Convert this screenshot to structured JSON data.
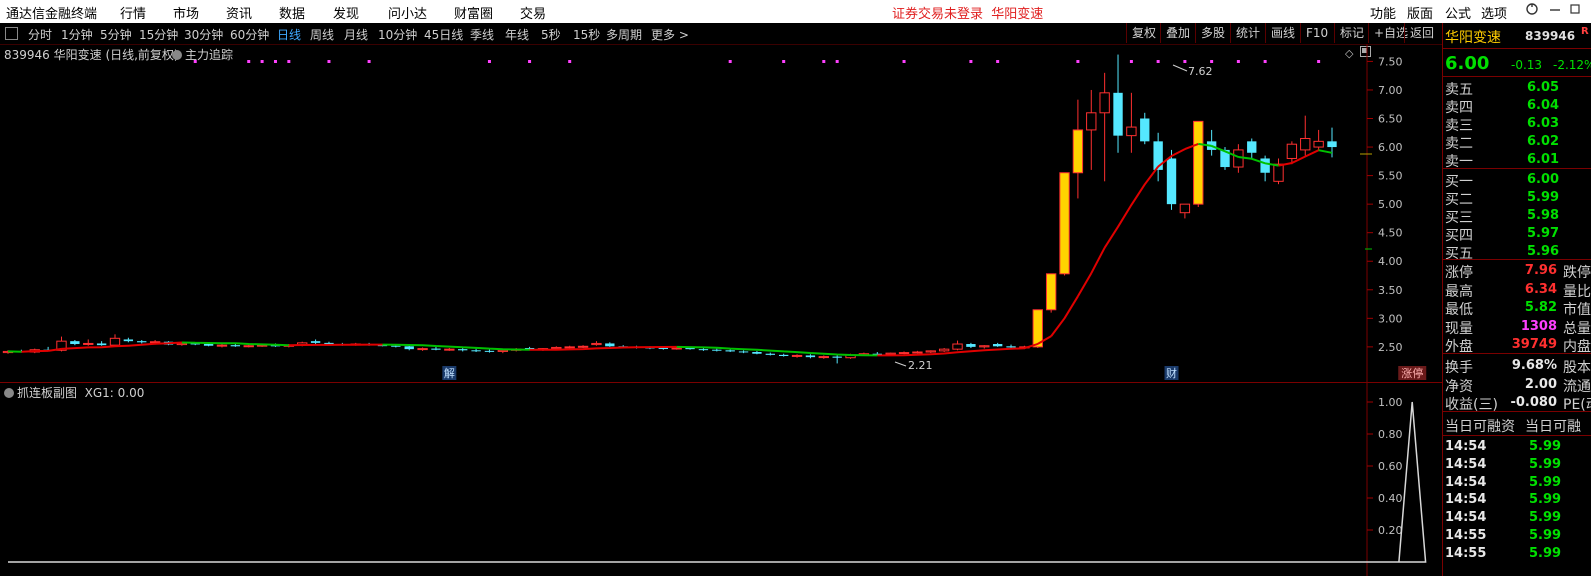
{
  "menubar": {
    "app_title": "通达信金融终端",
    "items": [
      "行情",
      "市场",
      "资讯",
      "数据",
      "发现",
      "问小达",
      "财富圈",
      "交易"
    ],
    "status_text": "证券交易未登录",
    "status_stock": "华阳变速",
    "right_items": [
      "功能",
      "版面",
      "公式",
      "选项"
    ],
    "controls": [
      "user-icon",
      "minimize-icon",
      "maximize-icon",
      "close-icon"
    ]
  },
  "periodbar": {
    "toggle_icon": "panel-toggle-icon",
    "periods": [
      "分时",
      "1分钟",
      "5分钟",
      "15分钟",
      "30分钟",
      "60分钟",
      "日线",
      "周线",
      "月线",
      "10分钟",
      "45日线",
      "季线",
      "年线",
      "5秒",
      "15秒",
      "多周期",
      "更多 >"
    ],
    "active_period": "日线",
    "tools": [
      "复权",
      "叠加",
      "多股",
      "统计",
      "画线",
      "F10",
      "标记",
      "+自选",
      "返回"
    ]
  },
  "main_chart": {
    "title": "839946 华阳变速 (日线,前复权)",
    "indicator": "主力追踪",
    "high_label": "7.62",
    "low_label": "2.21",
    "event_labels": [
      "解",
      "财",
      "涨停"
    ],
    "price_axis": [
      "7.50",
      "7.00",
      "6.50",
      "6.00",
      "5.50",
      "5.00",
      "4.50",
      "4.00",
      "3.50",
      "3.00",
      "2.50"
    ]
  },
  "sub_chart": {
    "title": "抓连板副图",
    "indicator_value": "XG1: 0.00",
    "axis": [
      "1.00",
      "0.80",
      "0.60",
      "0.40",
      "0.20"
    ]
  },
  "quote": {
    "name": "华阳变速",
    "code": "839946",
    "badge": "R",
    "price": "6.00",
    "change": "-0.13",
    "change_pct": "-2.12%",
    "asks": [
      {
        "label": "卖五",
        "price": "6.05"
      },
      {
        "label": "卖四",
        "price": "6.04"
      },
      {
        "label": "卖三",
        "price": "6.03"
      },
      {
        "label": "卖二",
        "price": "6.02"
      },
      {
        "label": "卖一",
        "price": "6.01"
      }
    ],
    "bids": [
      {
        "label": "买一",
        "price": "6.00"
      },
      {
        "label": "买二",
        "price": "5.99"
      },
      {
        "label": "买三",
        "price": "5.98"
      },
      {
        "label": "买四",
        "price": "5.97"
      },
      {
        "label": "买五",
        "price": "5.96"
      }
    ],
    "stats": [
      {
        "label": "涨停",
        "value": "7.96",
        "color": "red",
        "label2": "跌停"
      },
      {
        "label": "最高",
        "value": "6.34",
        "color": "red",
        "label2": "量比"
      },
      {
        "label": "最低",
        "value": "5.82",
        "color": "green",
        "label2": "市值"
      },
      {
        "label": "现量",
        "value": "1308",
        "color": "mag",
        "label2": "总量"
      },
      {
        "label": "外盘",
        "value": "39749",
        "color": "red",
        "label2": "内盘"
      }
    ],
    "stats2": [
      {
        "label": "换手",
        "value": "9.68%",
        "color": "white",
        "label2": "股本"
      },
      {
        "label": "净资",
        "value": "2.00",
        "color": "white",
        "label2": "流通"
      },
      {
        "label": "收益(三)",
        "value": "-0.080",
        "color": "white",
        "label2": "PE(动"
      }
    ],
    "margin_header": [
      "当日可融资",
      "当日可融"
    ],
    "ticks": [
      {
        "time": "14:54",
        "price": "5.99"
      },
      {
        "time": "14:54",
        "price": "5.99"
      },
      {
        "time": "14:54",
        "price": "5.99"
      },
      {
        "time": "14:54",
        "price": "5.99"
      },
      {
        "time": "14:54",
        "price": "5.99"
      },
      {
        "time": "14:55",
        "price": "5.99"
      },
      {
        "time": "14:55",
        "price": "5.99"
      }
    ]
  },
  "chart_data": {
    "type": "candlestick",
    "title": "839946 华阳变速 (日线,前复权)",
    "y_range": [
      2.2,
      7.7
    ],
    "candles": [
      {
        "o": 2.4,
        "h": 2.44,
        "l": 2.38,
        "c": 2.42
      },
      {
        "o": 2.42,
        "h": 2.45,
        "l": 2.4,
        "c": 2.41
      },
      {
        "o": 2.41,
        "h": 2.47,
        "l": 2.39,
        "c": 2.45
      },
      {
        "o": 2.45,
        "h": 2.5,
        "l": 2.43,
        "c": 2.44
      },
      {
        "o": 2.44,
        "h": 2.68,
        "l": 2.42,
        "c": 2.6
      },
      {
        "o": 2.6,
        "h": 2.62,
        "l": 2.53,
        "c": 2.55
      },
      {
        "o": 2.55,
        "h": 2.63,
        "l": 2.52,
        "c": 2.56
      },
      {
        "o": 2.56,
        "h": 2.6,
        "l": 2.52,
        "c": 2.53
      },
      {
        "o": 2.53,
        "h": 2.72,
        "l": 2.51,
        "c": 2.65
      },
      {
        "o": 2.63,
        "h": 2.66,
        "l": 2.58,
        "c": 2.6
      },
      {
        "o": 2.6,
        "h": 2.62,
        "l": 2.56,
        "c": 2.58
      },
      {
        "o": 2.58,
        "h": 2.62,
        "l": 2.54,
        "c": 2.59
      },
      {
        "o": 2.59,
        "h": 2.6,
        "l": 2.53,
        "c": 2.54
      },
      {
        "o": 2.54,
        "h": 2.58,
        "l": 2.52,
        "c": 2.56
      },
      {
        "o": 2.56,
        "h": 2.58,
        "l": 2.53,
        "c": 2.55
      },
      {
        "o": 2.55,
        "h": 2.57,
        "l": 2.51,
        "c": 2.52
      },
      {
        "o": 2.52,
        "h": 2.55,
        "l": 2.49,
        "c": 2.53
      },
      {
        "o": 2.53,
        "h": 2.56,
        "l": 2.5,
        "c": 2.51
      },
      {
        "o": 2.51,
        "h": 2.54,
        "l": 2.49,
        "c": 2.52
      },
      {
        "o": 2.52,
        "h": 2.55,
        "l": 2.5,
        "c": 2.53
      },
      {
        "o": 2.53,
        "h": 2.56,
        "l": 2.5,
        "c": 2.51
      },
      {
        "o": 2.51,
        "h": 2.55,
        "l": 2.49,
        "c": 2.53
      },
      {
        "o": 2.53,
        "h": 2.59,
        "l": 2.51,
        "c": 2.57
      },
      {
        "o": 2.6,
        "h": 2.63,
        "l": 2.55,
        "c": 2.57
      },
      {
        "o": 2.57,
        "h": 2.59,
        "l": 2.54,
        "c": 2.55
      },
      {
        "o": 2.55,
        "h": 2.57,
        "l": 2.52,
        "c": 2.54
      },
      {
        "o": 2.54,
        "h": 2.57,
        "l": 2.52,
        "c": 2.55
      },
      {
        "o": 2.55,
        "h": 2.57,
        "l": 2.52,
        "c": 2.53
      },
      {
        "o": 2.53,
        "h": 2.55,
        "l": 2.51,
        "c": 2.52
      },
      {
        "o": 2.52,
        "h": 2.54,
        "l": 2.49,
        "c": 2.51
      },
      {
        "o": 2.51,
        "h": 2.53,
        "l": 2.44,
        "c": 2.46
      },
      {
        "o": 2.46,
        "h": 2.49,
        "l": 2.43,
        "c": 2.47
      },
      {
        "o": 2.47,
        "h": 2.5,
        "l": 2.44,
        "c": 2.45
      },
      {
        "o": 2.45,
        "h": 2.48,
        "l": 2.43,
        "c": 2.46
      },
      {
        "o": 2.46,
        "h": 2.48,
        "l": 2.42,
        "c": 2.44
      },
      {
        "o": 2.44,
        "h": 2.47,
        "l": 2.41,
        "c": 2.43
      },
      {
        "o": 2.43,
        "h": 2.46,
        "l": 2.4,
        "c": 2.42
      },
      {
        "o": 2.42,
        "h": 2.45,
        "l": 2.39,
        "c": 2.44
      },
      {
        "o": 2.44,
        "h": 2.48,
        "l": 2.42,
        "c": 2.46
      },
      {
        "o": 2.48,
        "h": 2.5,
        "l": 2.44,
        "c": 2.45
      },
      {
        "o": 2.45,
        "h": 2.48,
        "l": 2.43,
        "c": 2.47
      },
      {
        "o": 2.47,
        "h": 2.51,
        "l": 2.45,
        "c": 2.49
      },
      {
        "o": 2.49,
        "h": 2.52,
        "l": 2.47,
        "c": 2.5
      },
      {
        "o": 2.5,
        "h": 2.53,
        "l": 2.48,
        "c": 2.51
      },
      {
        "o": 2.54,
        "h": 2.6,
        "l": 2.52,
        "c": 2.56
      },
      {
        "o": 2.56,
        "h": 2.58,
        "l": 2.5,
        "c": 2.51
      },
      {
        "o": 2.51,
        "h": 2.53,
        "l": 2.48,
        "c": 2.5
      },
      {
        "o": 2.5,
        "h": 2.52,
        "l": 2.47,
        "c": 2.49
      },
      {
        "o": 2.49,
        "h": 2.51,
        "l": 2.46,
        "c": 2.48
      },
      {
        "o": 2.48,
        "h": 2.5,
        "l": 2.45,
        "c": 2.47
      },
      {
        "o": 2.47,
        "h": 2.5,
        "l": 2.45,
        "c": 2.48
      },
      {
        "o": 2.48,
        "h": 2.5,
        "l": 2.45,
        "c": 2.46
      },
      {
        "o": 2.46,
        "h": 2.48,
        "l": 2.43,
        "c": 2.45
      },
      {
        "o": 2.45,
        "h": 2.47,
        "l": 2.42,
        "c": 2.44
      },
      {
        "o": 2.44,
        "h": 2.46,
        "l": 2.41,
        "c": 2.42
      },
      {
        "o": 2.42,
        "h": 2.44,
        "l": 2.39,
        "c": 2.41
      },
      {
        "o": 2.41,
        "h": 2.43,
        "l": 2.37,
        "c": 2.38
      },
      {
        "o": 2.38,
        "h": 2.4,
        "l": 2.35,
        "c": 2.36
      },
      {
        "o": 2.36,
        "h": 2.38,
        "l": 2.33,
        "c": 2.34
      },
      {
        "o": 2.34,
        "h": 2.37,
        "l": 2.31,
        "c": 2.35
      },
      {
        "o": 2.35,
        "h": 2.37,
        "l": 2.3,
        "c": 2.32
      },
      {
        "o": 2.32,
        "h": 2.35,
        "l": 2.29,
        "c": 2.33
      },
      {
        "o": 2.33,
        "h": 2.35,
        "l": 2.21,
        "c": 2.31
      },
      {
        "o": 2.31,
        "h": 2.38,
        "l": 2.29,
        "c": 2.36
      },
      {
        "o": 2.36,
        "h": 2.4,
        "l": 2.34,
        "c": 2.38
      },
      {
        "o": 2.38,
        "h": 2.41,
        "l": 2.35,
        "c": 2.37
      },
      {
        "o": 2.37,
        "h": 2.4,
        "l": 2.35,
        "c": 2.39
      },
      {
        "o": 2.39,
        "h": 2.42,
        "l": 2.37,
        "c": 2.4
      },
      {
        "o": 2.4,
        "h": 2.43,
        "l": 2.38,
        "c": 2.41
      },
      {
        "o": 2.41,
        "h": 2.44,
        "l": 2.39,
        "c": 2.43
      },
      {
        "o": 2.43,
        "h": 2.48,
        "l": 2.41,
        "c": 2.46
      },
      {
        "o": 2.46,
        "h": 2.61,
        "l": 2.44,
        "c": 2.55
      },
      {
        "o": 2.55,
        "h": 2.57,
        "l": 2.48,
        "c": 2.5
      },
      {
        "o": 2.5,
        "h": 2.53,
        "l": 2.47,
        "c": 2.52
      },
      {
        "o": 2.55,
        "h": 2.57,
        "l": 2.5,
        "c": 2.51
      },
      {
        "o": 2.51,
        "h": 2.54,
        "l": 2.48,
        "c": 2.49
      },
      {
        "o": 2.49,
        "h": 2.52,
        "l": 2.46,
        "c": 2.5
      },
      {
        "o": 2.5,
        "h": 3.15,
        "l": 2.48,
        "c": 3.15
      },
      {
        "o": 3.15,
        "h": 3.78,
        "l": 3.1,
        "c": 3.78
      },
      {
        "o": 3.78,
        "h": 5.55,
        "l": 3.75,
        "c": 5.55
      },
      {
        "o": 5.55,
        "h": 6.83,
        "l": 5.1,
        "c": 6.3
      },
      {
        "o": 6.3,
        "h": 7.0,
        "l": 5.6,
        "c": 6.6
      },
      {
        "o": 6.6,
        "h": 7.3,
        "l": 5.4,
        "c": 6.95
      },
      {
        "o": 6.95,
        "h": 7.62,
        "l": 5.9,
        "c": 6.2
      },
      {
        "o": 6.2,
        "h": 6.95,
        "l": 5.9,
        "c": 6.35
      },
      {
        "o": 6.5,
        "h": 6.6,
        "l": 6.05,
        "c": 6.1
      },
      {
        "o": 6.1,
        "h": 6.25,
        "l": 5.4,
        "c": 5.6
      },
      {
        "o": 5.8,
        "h": 5.95,
        "l": 4.9,
        "c": 5.0
      },
      {
        "o": 4.85,
        "h": 5.0,
        "l": 4.75,
        "c": 5.0
      },
      {
        "o": 5.0,
        "h": 6.45,
        "l": 4.95,
        "c": 6.45
      },
      {
        "o": 6.1,
        "h": 6.3,
        "l": 5.85,
        "c": 5.95
      },
      {
        "o": 5.95,
        "h": 6.0,
        "l": 5.6,
        "c": 5.65
      },
      {
        "o": 5.65,
        "h": 6.05,
        "l": 5.55,
        "c": 5.95
      },
      {
        "o": 6.1,
        "h": 6.15,
        "l": 5.8,
        "c": 5.9
      },
      {
        "o": 5.8,
        "h": 5.85,
        "l": 5.4,
        "c": 5.55
      },
      {
        "o": 5.4,
        "h": 5.8,
        "l": 5.35,
        "c": 5.7
      },
      {
        "o": 5.8,
        "h": 6.1,
        "l": 5.7,
        "c": 6.05
      },
      {
        "o": 5.95,
        "h": 6.55,
        "l": 5.85,
        "c": 6.15
      },
      {
        "o": 6.0,
        "h": 6.3,
        "l": 5.95,
        "c": 6.1
      },
      {
        "o": 6.1,
        "h": 6.34,
        "l": 5.82,
        "c": 6.0
      }
    ],
    "event_markers": [
      {
        "label": "解",
        "index": 33
      },
      {
        "label": "财",
        "index": 87
      },
      {
        "label": "涨停",
        "index": 105
      }
    ],
    "sub_indicator": {
      "name": "XG1",
      "values_nonzero": [
        {
          "index": 105,
          "value": 1.0
        }
      ],
      "y_range": [
        0,
        1.0
      ]
    }
  }
}
